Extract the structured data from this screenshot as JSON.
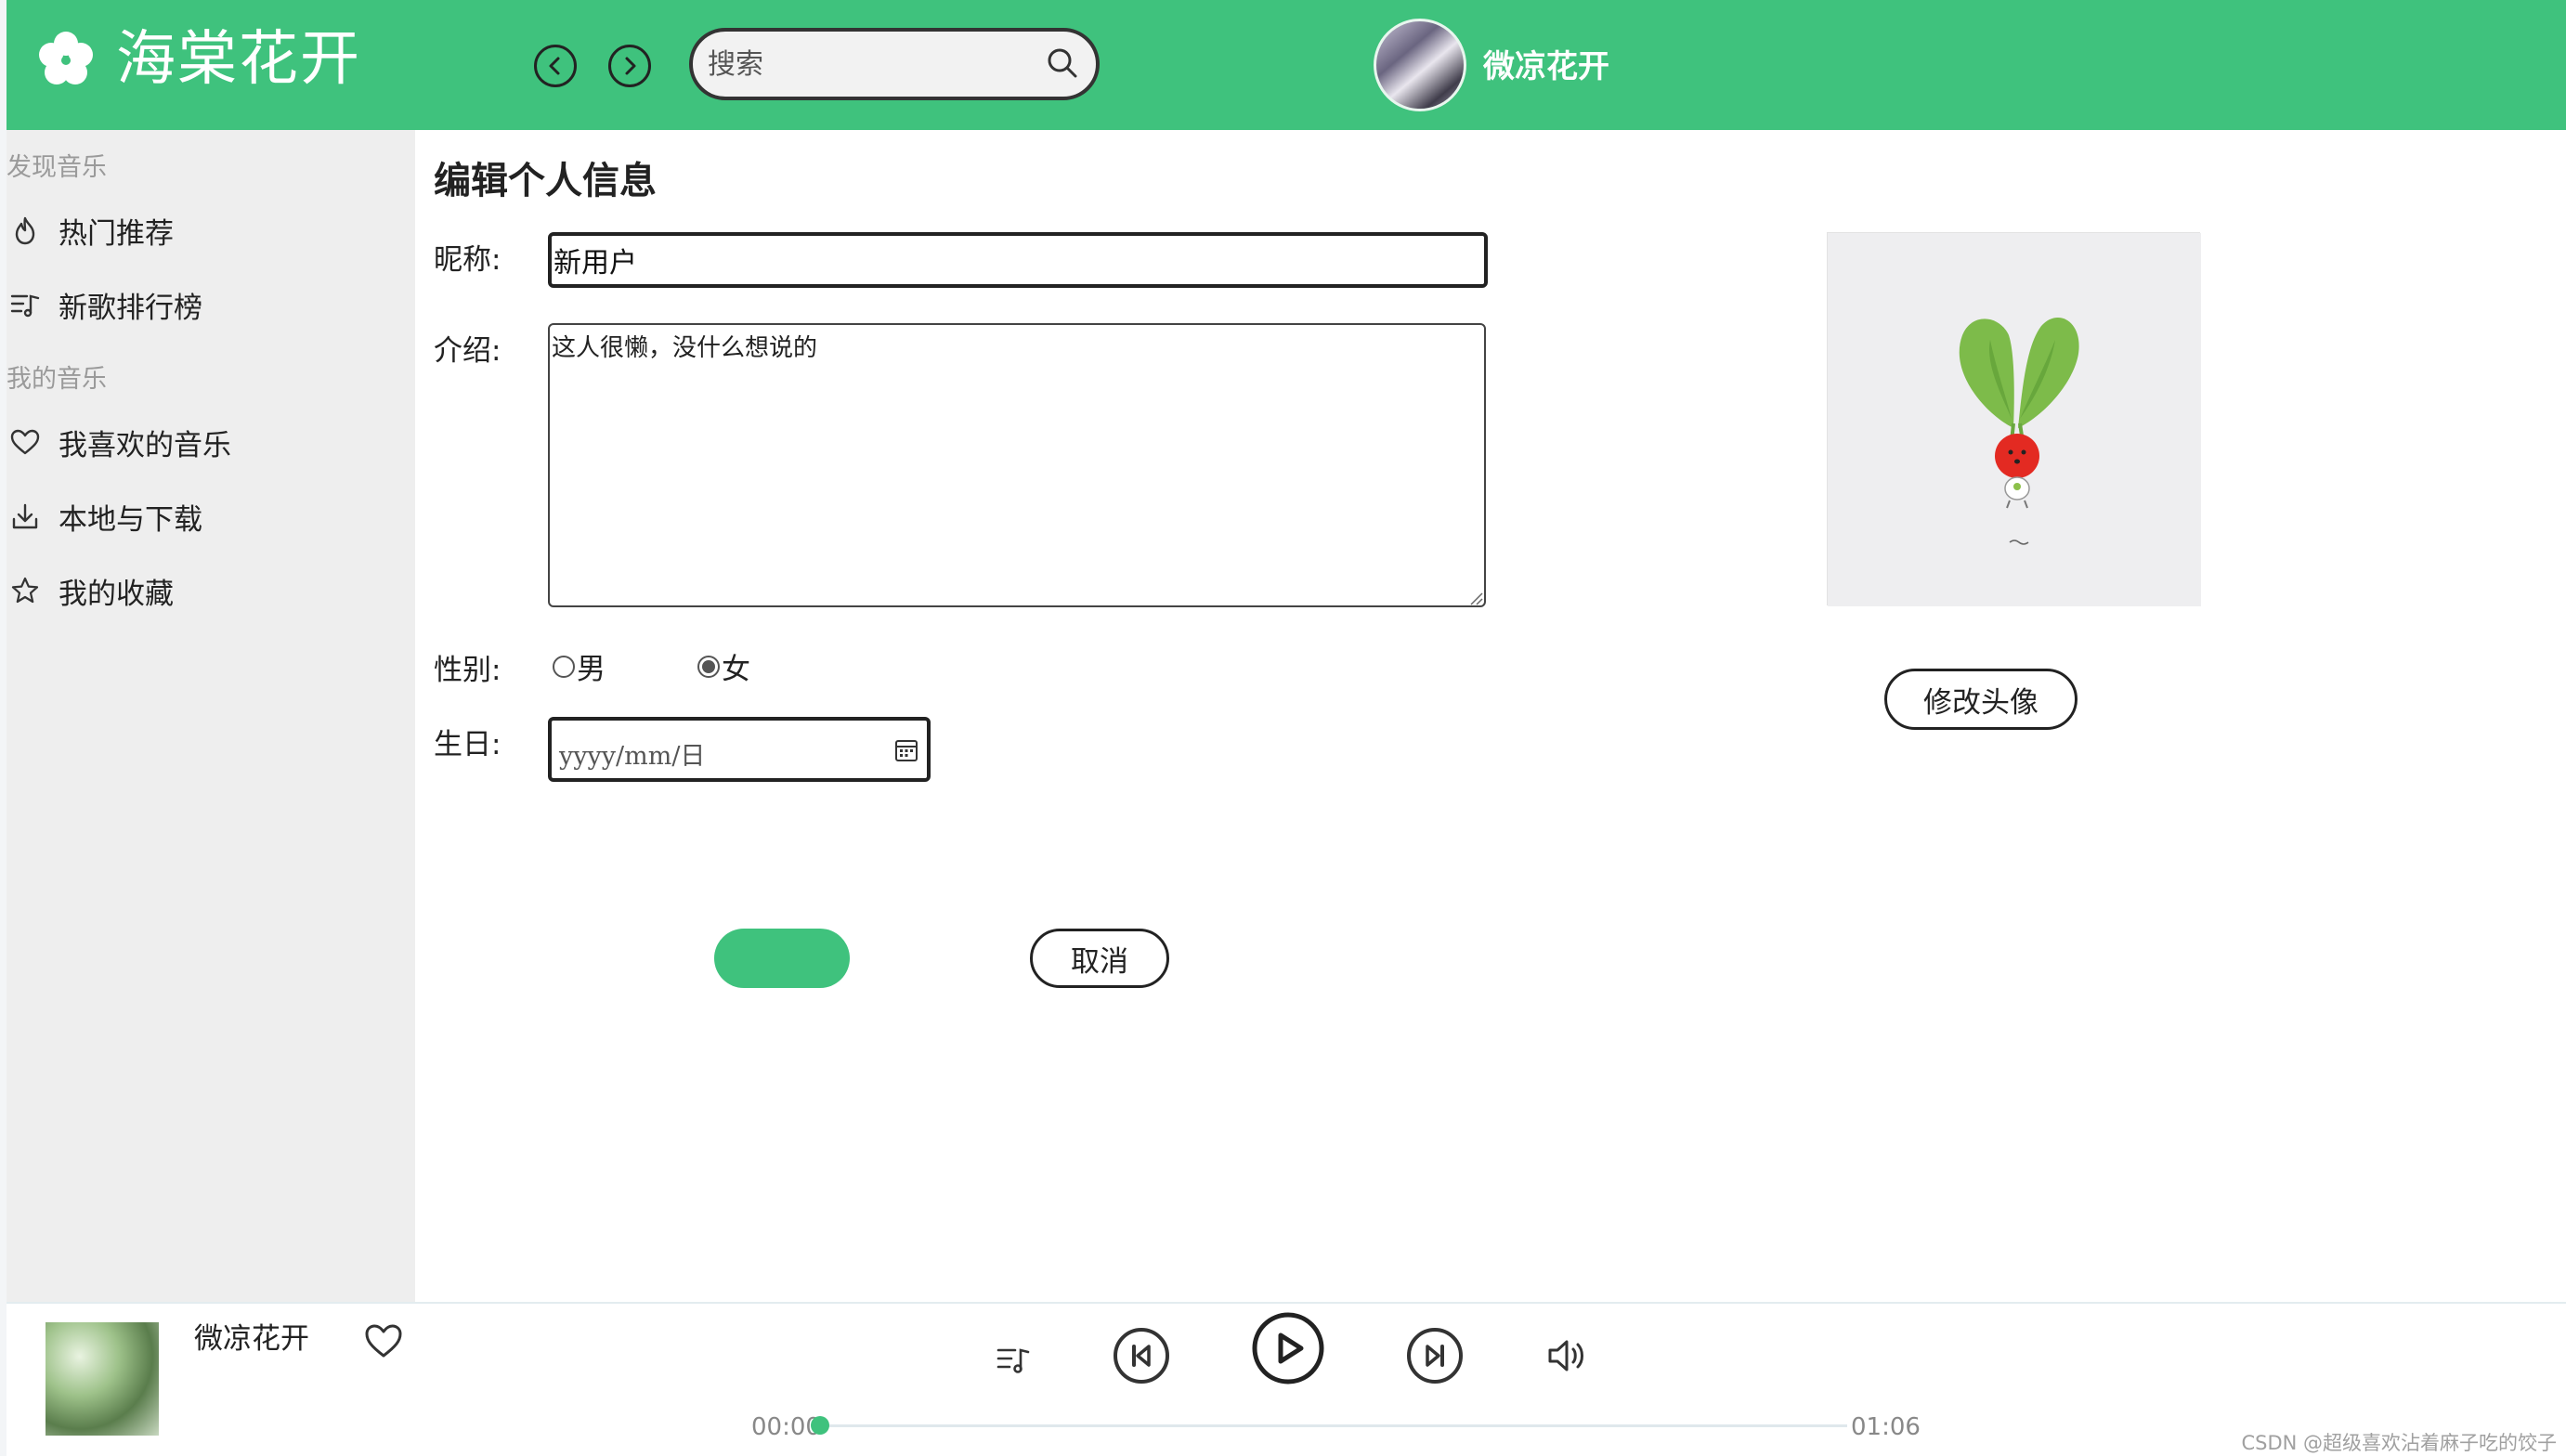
{
  "header": {
    "app_title": "海棠花开",
    "search_placeholder": "搜索",
    "username": "微凉花开",
    "brand_color": "#3fc27d"
  },
  "sidebar": {
    "sections": [
      {
        "title": "发现音乐",
        "items": [
          {
            "label": "热门推荐",
            "icon": "fire-icon"
          },
          {
            "label": "新歌排行榜",
            "icon": "playlist-icon"
          }
        ]
      },
      {
        "title": "我的音乐",
        "items": [
          {
            "label": "我喜欢的音乐",
            "icon": "heart-icon"
          },
          {
            "label": "本地与下载",
            "icon": "download-icon"
          },
          {
            "label": "我的收藏",
            "icon": "star-icon"
          }
        ]
      }
    ]
  },
  "form": {
    "title": "编辑个人信息",
    "nickname_label": "昵称:",
    "nickname_value": "新用户",
    "intro_label": "介绍:",
    "intro_value": "这人很懒，没什么想说的",
    "gender_label": "性别:",
    "gender_options": [
      "男",
      "女"
    ],
    "gender_selected": "女",
    "birthday_label": "生日:",
    "birthday_placeholder": "yyyy/mm/日",
    "save_label": "",
    "cancel_label": "取消",
    "change_avatar_label": "修改头像"
  },
  "player": {
    "song_name": "微凉花开",
    "current_time": "00:00",
    "total_time": "01:06",
    "progress": 0.0
  },
  "watermark": "CSDN @超级喜欢沾着麻子吃的饺子"
}
